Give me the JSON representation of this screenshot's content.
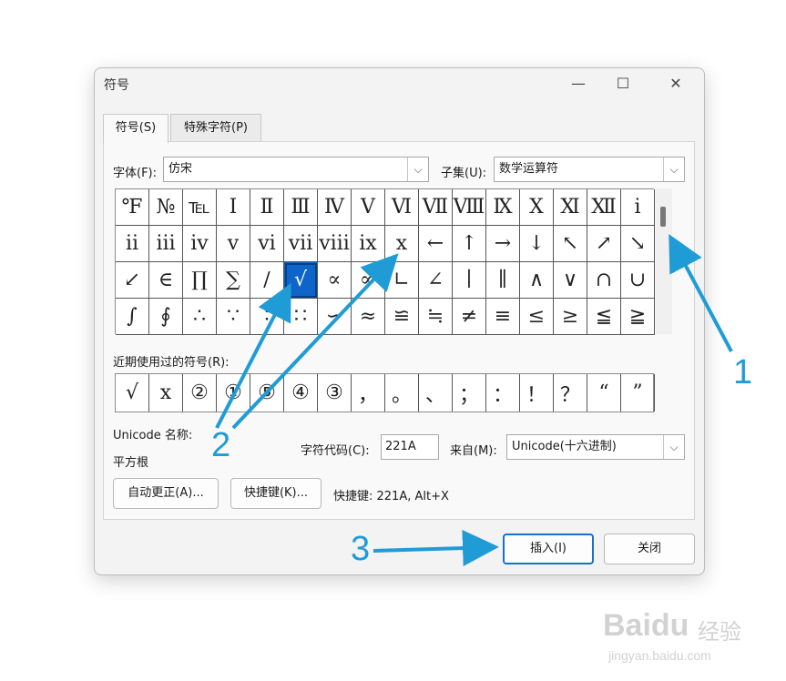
{
  "dialog": {
    "title": "符号",
    "controls": {
      "minimize": "—",
      "maximize": "☐",
      "close": "✕"
    },
    "tabs": [
      {
        "label": "符号(S)"
      },
      {
        "label": "特殊字符(P)"
      }
    ],
    "font": {
      "label": "字体(F):",
      "value": "仿宋"
    },
    "subset": {
      "label": "子集(U):",
      "value": "数学运算符"
    },
    "grid": {
      "rows": [
        [
          "℉",
          "№",
          "℡",
          "Ⅰ",
          "Ⅱ",
          "Ⅲ",
          "Ⅳ",
          "Ⅴ",
          "Ⅵ",
          "Ⅶ",
          "Ⅷ",
          "Ⅸ",
          "Ⅹ",
          "Ⅺ",
          "Ⅻ",
          "ⅰ"
        ],
        [
          "ⅱ",
          "ⅲ",
          "ⅳ",
          "ⅴ",
          "ⅵ",
          "ⅶ",
          "ⅷ",
          "ⅸ",
          "ⅹ",
          "←",
          "↑",
          "→",
          "↓",
          "↖",
          "↗",
          "↘"
        ],
        [
          "↙",
          "∈",
          "∏",
          "∑",
          "∕",
          "√",
          "∝",
          "∞",
          "∟",
          "∠",
          "∣",
          "∥",
          "∧",
          "∨",
          "∩",
          "∪"
        ],
        [
          "∫",
          "∮",
          "∴",
          "∵",
          "∶",
          "∷",
          "∽",
          "≈",
          "≌",
          "≒",
          "≠",
          "≡",
          "≤",
          "≥",
          "≦",
          "≧"
        ]
      ],
      "selected": {
        "row": 2,
        "col": 5
      }
    },
    "recent": {
      "label": "近期使用过的符号(R):",
      "symbols": [
        "√",
        "x",
        "②",
        "①",
        "⑤",
        "④",
        "③",
        "，",
        "。",
        "、",
        "；",
        "：",
        "！",
        "？",
        "“",
        "”"
      ]
    },
    "unicode_name": {
      "label": "Unicode 名称:",
      "value": "平方根"
    },
    "char_code": {
      "label": "字符代码(C):",
      "value": "221A"
    },
    "from": {
      "label": "来自(M):",
      "value": "Unicode(十六进制)"
    },
    "buttons": {
      "autocorrect": "自动更正(A)...",
      "shortcut_key": "快捷键(K)...",
      "insert": "插入(I)",
      "close": "关闭"
    },
    "shortcut_info": "快捷键: 221A, Alt+X"
  },
  "annotations": {
    "label1": "1",
    "label2": "2",
    "label3": "3",
    "color": "#1f9cd6"
  },
  "watermark": {
    "brand": "Baidu",
    "brand2": "经验",
    "url": "jingyan.baidu.com"
  }
}
